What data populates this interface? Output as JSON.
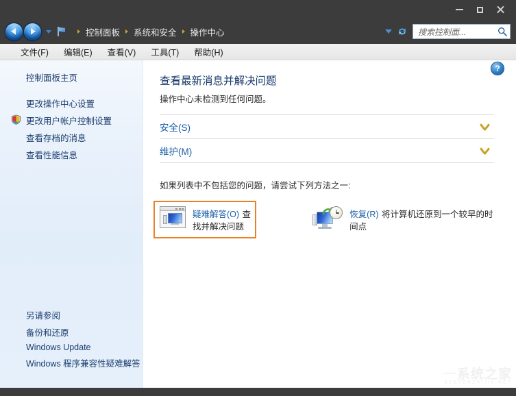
{
  "window": {
    "controls": {
      "minimize": "minimize-button",
      "maximize": "maximize-button",
      "close": "close-button"
    }
  },
  "nav": {
    "back": "back-button",
    "forward": "forward-button",
    "recent_pages": "recent-pages-dropdown",
    "breadcrumb": [
      "控制面板",
      "系统和安全",
      "操作中心"
    ],
    "address_dropdown": "address-dropdown",
    "refresh": "refresh-button"
  },
  "search": {
    "placeholder": "搜索控制面...",
    "value": ""
  },
  "menubar": {
    "items": [
      "文件(F)",
      "编辑(E)",
      "查看(V)",
      "工具(T)",
      "帮助(H)"
    ]
  },
  "sidebar": {
    "home": "控制面板主页",
    "items": [
      {
        "label": "更改操作中心设置",
        "shield": false
      },
      {
        "label": "更改用户帐户控制设置",
        "shield": true
      },
      {
        "label": "查看存档的消息",
        "shield": false
      },
      {
        "label": "查看性能信息",
        "shield": false
      }
    ],
    "see_also": {
      "title": "另请参阅",
      "items": [
        "备份和还原",
        "Windows Update",
        "Windows 程序兼容性疑难解答"
      ]
    }
  },
  "content": {
    "help": "?",
    "title": "查看最新消息并解决问题",
    "subtitle": "操作中心未检测到任何问题。",
    "sections": [
      {
        "label": "安全(S)",
        "expanded": false
      },
      {
        "label": "维护(M)",
        "expanded": false
      }
    ],
    "try_text": "如果列表中不包括您的问题，请尝试下列方法之一:",
    "actions": [
      {
        "title": "疑难解答(O)",
        "desc": "查找并解决问题",
        "highlighted": true,
        "icon": "troubleshoot-icon"
      },
      {
        "title": "恢复(R)",
        "desc": "将计算机还原到一个较早的时间点",
        "highlighted": false,
        "icon": "recovery-icon"
      }
    ]
  },
  "watermark": {
    "dash": "一",
    "text": "系统之家",
    "sub": "SYSTEMZHIJIA.NET"
  },
  "colors": {
    "titlebar": "#3c3c3c",
    "accent_link": "#1b5fa8",
    "sidebar_link": "#1b3d6e",
    "highlight_border": "#e58326",
    "chevron": "#c9a227"
  }
}
